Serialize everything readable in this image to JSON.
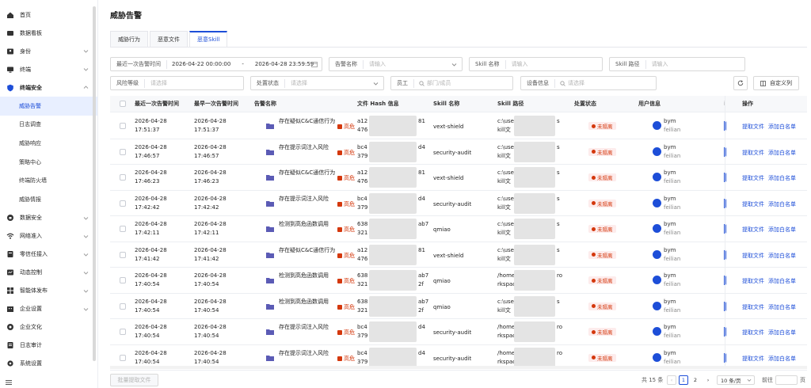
{
  "sidebar": {
    "items": [
      {
        "label": "首页",
        "icon": "home-icon",
        "chev": false
      },
      {
        "label": "数据看板",
        "icon": "dashboard-icon",
        "chev": false
      },
      {
        "label": "身份",
        "icon": "identity-icon",
        "chev": true
      },
      {
        "label": "终端",
        "icon": "terminal-icon",
        "chev": true
      },
      {
        "label": "终端安全",
        "icon": "shield-icon",
        "chev": true,
        "open": true
      },
      {
        "label": "数据安全",
        "icon": "data-security-icon",
        "chev": true
      },
      {
        "label": "网络准入",
        "icon": "wifi-icon",
        "chev": true
      },
      {
        "label": "零信任接入",
        "icon": "zero-trust-icon",
        "chev": true
      },
      {
        "label": "动态控制",
        "icon": "dynamic-control-icon",
        "chev": true
      },
      {
        "label": "智能体发布",
        "icon": "agent-icon",
        "chev": true
      },
      {
        "label": "企业设置",
        "icon": "enterprise-icon",
        "chev": true
      },
      {
        "label": "企业文化",
        "icon": "culture-icon",
        "chev": false
      },
      {
        "label": "日志审计",
        "icon": "audit-icon",
        "chev": false
      },
      {
        "label": "系统设置",
        "icon": "settings-icon",
        "chev": false
      }
    ],
    "subitems": [
      "威胁告警",
      "日志调查",
      "威胁响应",
      "策略中心",
      "终端防火墙",
      "威胁情报"
    ]
  },
  "page": {
    "title": "威胁告警"
  },
  "tabs": [
    "威胁行为",
    "恶意文件",
    "恶意Skill"
  ],
  "filters": {
    "time_label": "最近一次告警时间",
    "time_start": "2026-04-22 00:00:00",
    "time_sep": "-",
    "time_end": "2026-04-28 23:59:59",
    "alert_name_label": "告警名称",
    "alert_name_ph": "请输入",
    "skill_name_label": "Skill 名称",
    "skill_name_ph": "请输入",
    "skill_path_label": "Skill 路径",
    "skill_path_ph": "请输入",
    "risk_label": "风险等级",
    "risk_ph": "请选择",
    "status_label": "处置状态",
    "status_ph": "请选择",
    "employee_label": "员工",
    "employee_ph": "部门/成员",
    "device_label": "设备信息",
    "device_ph": "请选择",
    "custom_col_label": "自定义列"
  },
  "table": {
    "columns": [
      "最近一次告警时间",
      "最早一次告警时间",
      "告警名称",
      "文件 Hash 信息",
      "Skill 名称",
      "Skill 路径",
      "处置状态",
      "用户信息",
      "操作"
    ],
    "rows": [
      {
        "last": [
          "2026-04-28",
          "17:51:37"
        ],
        "first": [
          "2026-04-28",
          "17:51:37"
        ],
        "name": "存在疑似C&C通信行为",
        "sev": "高危",
        "hash": [
          "a12",
          "476"
        ],
        "hash_tail": [
          "81",
          ""
        ],
        "skill": "vext-shield",
        "path": [
          "c:\\use",
          "kill文"
        ],
        "path_tail": [
          "s",
          ""
        ],
        "status": "未隔离",
        "user": "bym",
        "org": "feilian"
      },
      {
        "last": [
          "2026-04-28",
          "17:46:57"
        ],
        "first": [
          "2026-04-28",
          "17:46:57"
        ],
        "name": "存在提示词注入风险",
        "sev": "高危",
        "hash": [
          "bc4",
          "379"
        ],
        "hash_tail": [
          "d4",
          ""
        ],
        "skill": "security-audit",
        "path": [
          "c:\\use",
          "kill文"
        ],
        "path_tail": [
          "s",
          ""
        ],
        "status": "未隔离",
        "user": "bym",
        "org": "feilian"
      },
      {
        "last": [
          "2026-04-28",
          "17:46:23"
        ],
        "first": [
          "2026-04-28",
          "17:46:23"
        ],
        "name": "存在疑似C&C通信行为",
        "sev": "高危",
        "hash": [
          "a12",
          "476"
        ],
        "hash_tail": [
          "81",
          ""
        ],
        "skill": "vext-shield",
        "path": [
          "c:\\use",
          "kill文"
        ],
        "path_tail": [
          "s",
          ""
        ],
        "status": "未隔离",
        "user": "bym",
        "org": "feilian"
      },
      {
        "last": [
          "2026-04-28",
          "17:42:42"
        ],
        "first": [
          "2026-04-28",
          "17:42:42"
        ],
        "name": "存在提示词注入风险",
        "sev": "高危",
        "hash": [
          "bc4",
          "379"
        ],
        "hash_tail": [
          "d4",
          ""
        ],
        "skill": "security-audit",
        "path": [
          "c:\\use",
          "kill文"
        ],
        "path_tail": [
          "s",
          ""
        ],
        "status": "未隔离",
        "user": "bym",
        "org": "feilian"
      },
      {
        "last": [
          "2026-04-28",
          "17:42:11"
        ],
        "first": [
          "2026-04-28",
          "17:42:11"
        ],
        "name": "检测到高危函数调用",
        "sev": "高危",
        "hash": [
          "638",
          "321"
        ],
        "hash_tail": [
          "ab7",
          ""
        ],
        "skill": "qmiao",
        "path": [
          "c:\\use",
          "kill文"
        ],
        "path_tail": [
          "s",
          ""
        ],
        "status": "未隔离",
        "user": "bym",
        "org": "feilian"
      },
      {
        "last": [
          "2026-04-28",
          "17:41:42"
        ],
        "first": [
          "2026-04-28",
          "17:41:42"
        ],
        "name": "存在疑似C&C通信行为",
        "sev": "高危",
        "hash": [
          "a12",
          "476"
        ],
        "hash_tail": [
          "81",
          ""
        ],
        "skill": "vext-shield",
        "path": [
          "c:\\use",
          "kill文"
        ],
        "path_tail": [
          "s",
          ""
        ],
        "status": "未隔离",
        "user": "bym",
        "org": "feilian"
      },
      {
        "last": [
          "2026-04-28",
          "17:40:54"
        ],
        "first": [
          "2026-04-28",
          "17:40:54"
        ],
        "name": "检测到高危函数调用",
        "sev": "高危",
        "hash": [
          "638",
          "321"
        ],
        "hash_tail": [
          "ab7",
          "2f"
        ],
        "skill": "qmiao",
        "path": [
          "/home",
          "rkspac"
        ],
        "path_tail": [
          "ro",
          ""
        ],
        "status": "未隔离",
        "user": "bym",
        "org": "feilian"
      },
      {
        "last": [
          "2026-04-28",
          "17:40:54"
        ],
        "first": [
          "2026-04-28",
          "17:40:54"
        ],
        "name": "检测到高危函数调用",
        "sev": "高危",
        "hash": [
          "638",
          "321"
        ],
        "hash_tail": [
          "ab7",
          "2f"
        ],
        "skill": "qmiao",
        "path": [
          "c:\\use",
          "kill文"
        ],
        "path_tail": [
          "s",
          ""
        ],
        "status": "未隔离",
        "user": "bym",
        "org": "feilian"
      },
      {
        "last": [
          "2026-04-28",
          "17:40:54"
        ],
        "first": [
          "2026-04-28",
          "17:40:54"
        ],
        "name": "存在提示词注入风险",
        "sev": "高危",
        "hash": [
          "bc4",
          "379"
        ],
        "hash_tail": [
          "d4",
          ""
        ],
        "skill": "security-audit",
        "path": [
          "/home",
          "rkspac"
        ],
        "path_tail": [
          "ro",
          ""
        ],
        "status": "未隔离",
        "user": "bym",
        "org": "feilian"
      },
      {
        "last": [
          "2026-04-28",
          "17:40:54"
        ],
        "first": [
          "2026-04-28",
          "17:40:54"
        ],
        "name": "存在提示词注入风险",
        "sev": "高危",
        "hash": [
          "bc4",
          "379"
        ],
        "hash_tail": [
          "d4",
          ""
        ],
        "skill": "security-audit",
        "path": [
          "/home",
          "rkspac"
        ],
        "path_tail": [
          "ro",
          ""
        ],
        "status": "未隔离",
        "user": "bym",
        "org": "feilian"
      }
    ],
    "actions": [
      "提取文件",
      "添加白名单"
    ]
  },
  "footer": {
    "batch_label": "批量提取文件",
    "total": "共 15 条",
    "page1": "1",
    "page2": "2",
    "page_size": "10 条/页",
    "goto_label": "前往",
    "goto_unit": "页"
  },
  "colors": {
    "accent": "#1d4ed8",
    "danger": "#d4380d"
  }
}
